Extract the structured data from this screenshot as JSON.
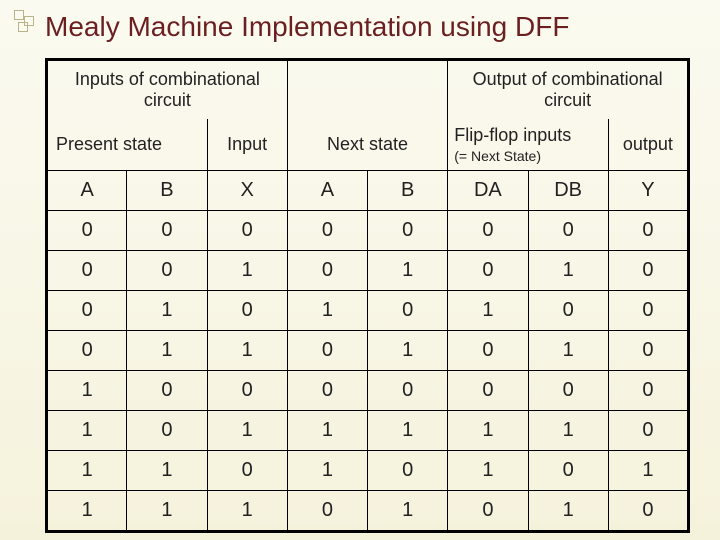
{
  "title": "Mealy Machine Implementation using DFF",
  "super_headers": {
    "inputs": "Inputs of combinational circuit",
    "blank": "",
    "outputs": "Output of combinational circuit"
  },
  "group_headers": {
    "present_state": "Present state",
    "input": "Input",
    "next_state": "Next state",
    "ff_inputs": "Flip-flop inputs",
    "ff_sub": "(= Next State)",
    "output": "output"
  },
  "columns": [
    "A",
    "B",
    "X",
    "A",
    "B",
    "DA",
    "DB",
    "Y"
  ],
  "rows": [
    [
      "0",
      "0",
      "0",
      "0",
      "0",
      "0",
      "0",
      "0"
    ],
    [
      "0",
      "0",
      "1",
      "0",
      "1",
      "0",
      "1",
      "0"
    ],
    [
      "0",
      "1",
      "0",
      "1",
      "0",
      "1",
      "0",
      "0"
    ],
    [
      "0",
      "1",
      "1",
      "0",
      "1",
      "0",
      "1",
      "0"
    ],
    [
      "1",
      "0",
      "0",
      "0",
      "0",
      "0",
      "0",
      "0"
    ],
    [
      "1",
      "0",
      "1",
      "1",
      "1",
      "1",
      "1",
      "0"
    ],
    [
      "1",
      "1",
      "0",
      "1",
      "0",
      "1",
      "0",
      "1"
    ],
    [
      "1",
      "1",
      "1",
      "0",
      "1",
      "0",
      "1",
      "0"
    ]
  ],
  "chart_data": {
    "type": "table",
    "title": "Mealy Machine Implementation using DFF",
    "columns": [
      "A",
      "B",
      "X",
      "A_next",
      "B_next",
      "DA",
      "DB",
      "Y"
    ],
    "rows": [
      [
        0,
        0,
        0,
        0,
        0,
        0,
        0,
        0
      ],
      [
        0,
        0,
        1,
        0,
        1,
        0,
        1,
        0
      ],
      [
        0,
        1,
        0,
        1,
        0,
        1,
        0,
        0
      ],
      [
        0,
        1,
        1,
        0,
        1,
        0,
        1,
        0
      ],
      [
        1,
        0,
        0,
        0,
        0,
        0,
        0,
        0
      ],
      [
        1,
        0,
        1,
        1,
        1,
        1,
        1,
        0
      ],
      [
        1,
        1,
        0,
        1,
        0,
        1,
        0,
        1
      ],
      [
        1,
        1,
        1,
        0,
        1,
        0,
        1,
        0
      ]
    ]
  }
}
